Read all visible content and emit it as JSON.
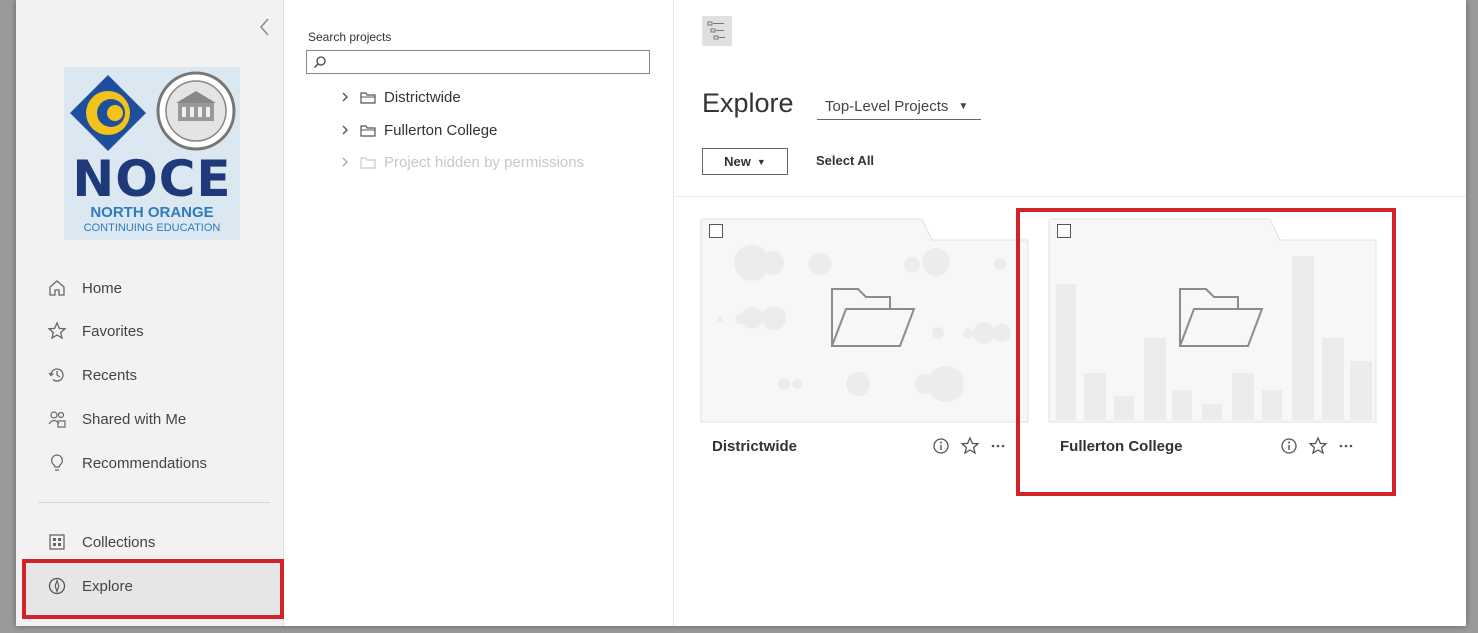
{
  "sidebar": {
    "logo": {
      "brand": "NOCE",
      "line1": "NORTH ORANGE",
      "line2": "CONTINUING EDUCATION"
    },
    "items": [
      {
        "label": "Home",
        "icon": "home-icon"
      },
      {
        "label": "Favorites",
        "icon": "star-icon"
      },
      {
        "label": "Recents",
        "icon": "clock-icon"
      },
      {
        "label": "Shared with Me",
        "icon": "people-icon"
      },
      {
        "label": "Recommendations",
        "icon": "lightbulb-icon"
      },
      {
        "label": "Collections",
        "icon": "collections-icon"
      },
      {
        "label": "Explore",
        "icon": "compass-icon",
        "active": true
      }
    ]
  },
  "tree": {
    "search_label": "Search projects",
    "search_placeholder": "",
    "items": [
      {
        "label": "Districtwide"
      },
      {
        "label": "Fullerton College"
      },
      {
        "label": "Project hidden by permissions",
        "disabled": true
      }
    ]
  },
  "main": {
    "title": "Explore",
    "filter": "Top-Level Projects",
    "new_label": "New",
    "select_all_label": "Select All",
    "cards": [
      {
        "name": "Districtwide",
        "thumbnail": "circles"
      },
      {
        "name": "Fullerton College",
        "thumbnail": "bars",
        "highlighted": true
      }
    ]
  },
  "colors": {
    "highlight": "#d0232a",
    "logo_blue": "#1e4f9c",
    "logo_gold": "#f3c21b",
    "logo_navy": "#1f3a7a"
  }
}
